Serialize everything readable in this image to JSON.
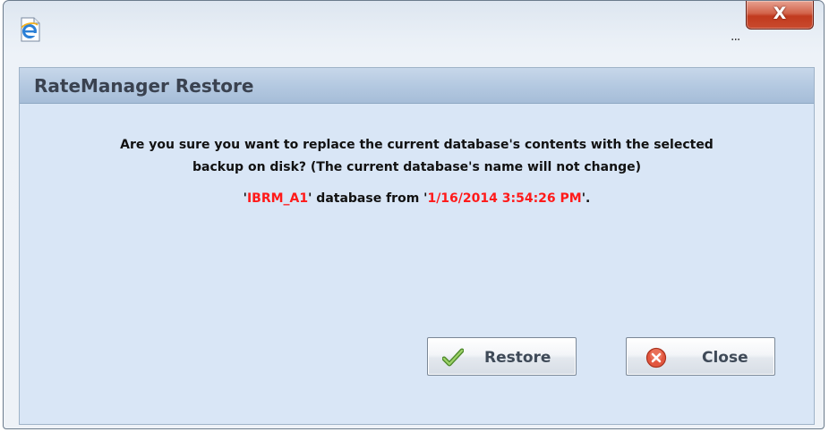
{
  "window": {
    "close_glyph": "X",
    "minimized_dots": "..."
  },
  "dialog": {
    "title": "RateManager Restore",
    "message_line1": "Are you sure you want to replace the current database's contents with the selected",
    "message_line2": "backup on disk? (The current database's name will not change)",
    "detail": {
      "quote_open": "'",
      "database_name": "IBRM_A1",
      "middle_text": "' database from '",
      "backup_datetime": "1/16/2014 3:54:26 PM",
      "quote_close": "'."
    }
  },
  "buttons": {
    "restore_label": "Restore",
    "close_label": "Close"
  },
  "icons": {
    "window_icon": "ie-icon",
    "restore_icon": "checkmark-icon",
    "close_icon": "close-circle-icon"
  },
  "colors": {
    "highlight_text": "#ff1a1a",
    "dialog_background": "#d9e6f6",
    "header_band": "#b4c9e1",
    "close_button": "#c94a2e"
  }
}
